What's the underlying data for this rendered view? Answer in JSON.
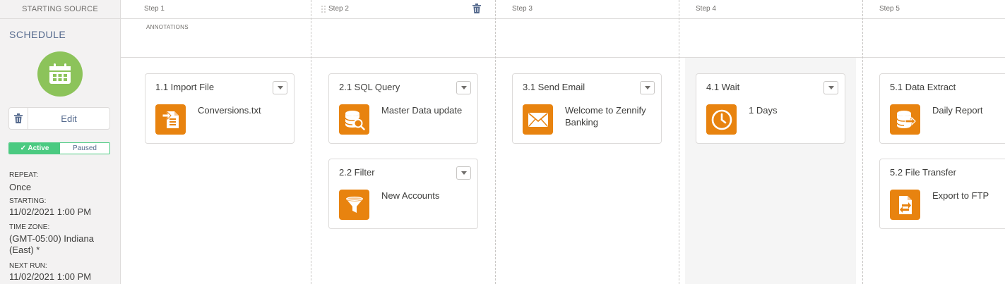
{
  "left": {
    "header": "STARTING SOURCE",
    "title": "SCHEDULE",
    "edit_label": "Edit",
    "active_label": "✓ Active",
    "paused_label": "Paused",
    "repeat_label": "REPEAT:",
    "repeat_value": "Once",
    "starting_label": "STARTING:",
    "starting_value": "11/02/2021 1:00 PM",
    "timezone_label": "TIME ZONE:",
    "timezone_line1": "(GMT-05:00) Indiana",
    "timezone_line2": "(East) *",
    "nextrun_label": "NEXT RUN:",
    "nextrun_value": "11/02/2021 1:00 PM"
  },
  "annotations_label": "ANNOTATIONS",
  "steps": [
    {
      "label": "Step 1"
    },
    {
      "label": "Step 2"
    },
    {
      "label": "Step 3"
    },
    {
      "label": "Step 4"
    },
    {
      "label": "Step 5"
    }
  ],
  "cards": {
    "c11": {
      "title": "1.1 Import File",
      "text": "Conversions.txt",
      "icon": "file-import-icon"
    },
    "c21": {
      "title": "2.1 SQL Query",
      "text": "Master Data update",
      "icon": "database-search-icon"
    },
    "c22": {
      "title": "2.2 Filter",
      "text": "New Accounts",
      "icon": "filter-icon"
    },
    "c31": {
      "title": "3.1 Send Email",
      "text": "Welcome to Zennify Banking",
      "icon": "envelope-icon"
    },
    "c41": {
      "title": "4.1 Wait",
      "text": "1 Days",
      "icon": "clock-icon"
    },
    "c51": {
      "title": "5.1 Data Extract",
      "text": "Daily Report",
      "icon": "data-extract-icon"
    },
    "c52": {
      "title": "5.2 File Transfer",
      "text": "Export to FTP",
      "icon": "file-transfer-icon"
    }
  },
  "colors": {
    "activity_orange": "#e8830f",
    "schedule_green": "#8cc35a",
    "active_green": "#4bca81",
    "link_blue": "#54698d"
  }
}
